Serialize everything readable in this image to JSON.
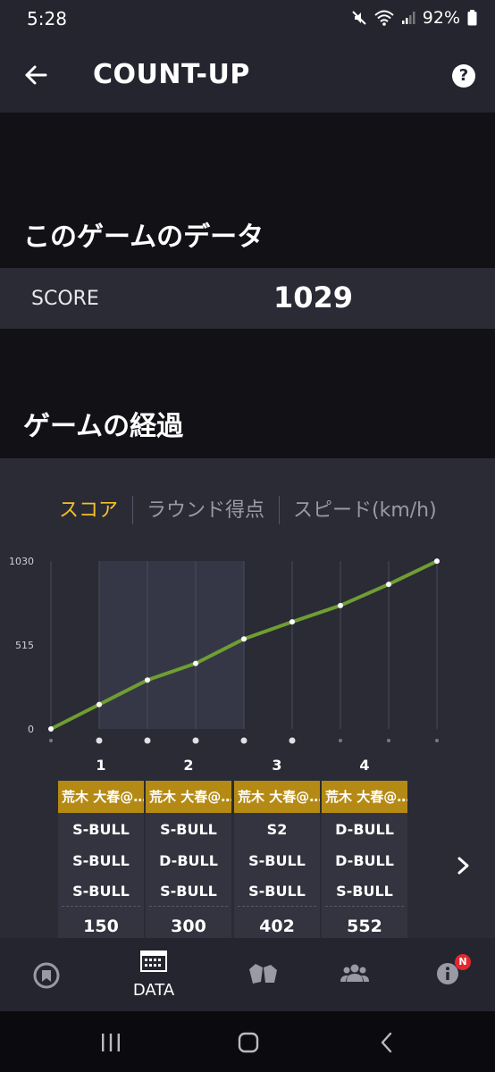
{
  "status": {
    "time": "5:28",
    "battery": "92%"
  },
  "app_bar": {
    "title": "COUNT-UP"
  },
  "this_game": {
    "title": "このゲームのデータ",
    "score_label": "SCORE",
    "score_value": "1029"
  },
  "progress": {
    "title": "ゲームの経過",
    "tabs": [
      {
        "label": "スコア",
        "active": true
      },
      {
        "label": "ラウンド得点",
        "active": false
      },
      {
        "label": "スピード(km/h)",
        "active": false
      }
    ]
  },
  "chart_data": {
    "type": "line",
    "title": "",
    "xlabel": "",
    "ylabel": "",
    "y_ticks": [
      "1030",
      "515",
      "0"
    ],
    "ylim": [
      0,
      1030
    ],
    "x": [
      0,
      1,
      2,
      3,
      4,
      5,
      6,
      7,
      8
    ],
    "series": [
      {
        "values": [
          0,
          150,
          300,
          402,
          552,
          657,
          757,
          887,
          1029
        ]
      }
    ],
    "line_color": "#6f9e32",
    "highlighted_rounds": [
      1,
      2,
      3,
      4
    ]
  },
  "rounds": [
    {
      "number": "1",
      "player": "荒木 大春@…",
      "darts": [
        "S-BULL",
        "S-BULL",
        "S-BULL"
      ],
      "total": "150"
    },
    {
      "number": "2",
      "player": "荒木 大春@…",
      "darts": [
        "S-BULL",
        "D-BULL",
        "S-BULL"
      ],
      "total": "300"
    },
    {
      "number": "3",
      "player": "荒木 大春@…",
      "darts": [
        "S2",
        "S-BULL",
        "S-BULL"
      ],
      "total": "402"
    },
    {
      "number": "4",
      "player": "荒木 大春@…",
      "darts": [
        "D-BULL",
        "D-BULL",
        "S-BULL"
      ],
      "total": "552"
    }
  ],
  "bottom_nav": {
    "items": [
      {
        "label": "",
        "icon": "dartboard-icon"
      },
      {
        "label": "DATA",
        "icon": "calendar-icon"
      },
      {
        "label": "",
        "icon": "versus-icon"
      },
      {
        "label": "",
        "icon": "friends-icon"
      },
      {
        "label": "",
        "icon": "info-icon",
        "badge": "N"
      }
    ]
  },
  "colors": {
    "accent": "#f3c22a",
    "player_tag": "#b58a14",
    "line": "#6f9e32",
    "badge": "#e0282e"
  }
}
